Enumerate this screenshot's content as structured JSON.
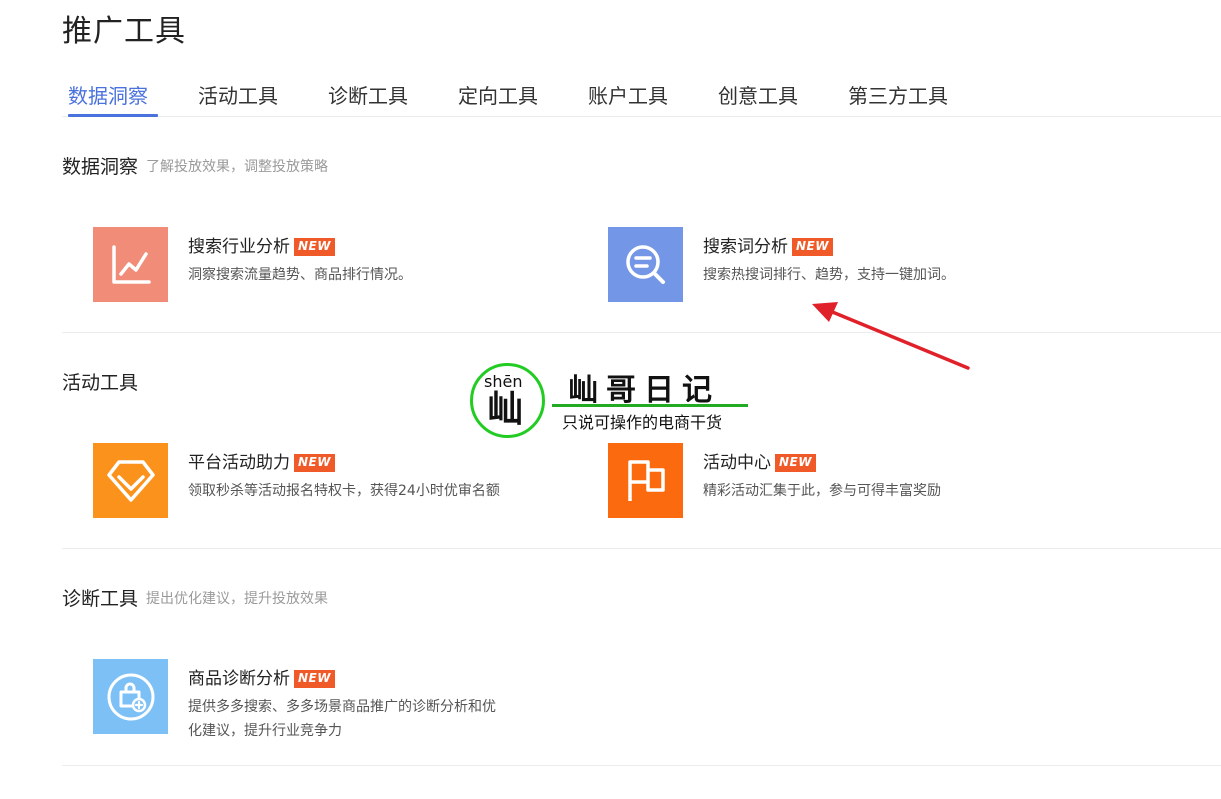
{
  "page_title": "推广工具",
  "tabs": [
    {
      "label": "数据洞察",
      "active": true
    },
    {
      "label": "活动工具",
      "active": false
    },
    {
      "label": "诊断工具",
      "active": false
    },
    {
      "label": "定向工具",
      "active": false
    },
    {
      "label": "账户工具",
      "active": false
    },
    {
      "label": "创意工具",
      "active": false
    },
    {
      "label": "第三方工具",
      "active": false
    }
  ],
  "sections": {
    "insight": {
      "title": "数据洞察",
      "desc": "了解投放效果，调整投放策略",
      "cards": [
        {
          "name": "搜索行业分析",
          "badge": "NEW",
          "desc": "洞察搜索流量趋势、商品排行情况。",
          "icon": "line-chart-icon",
          "color": "#f08c77"
        },
        {
          "name": "搜索词分析",
          "badge": "NEW",
          "desc": "搜索热搜词排行、趋势，支持一键加词。",
          "icon": "search-list-icon",
          "color": "#7397e6"
        }
      ]
    },
    "activity": {
      "title": "活动工具",
      "cards": [
        {
          "name": "平台活动助力",
          "badge": "NEW",
          "desc": "领取秒杀等活动报名特权卡，获得24小时优审名额",
          "icon": "diamond-icon",
          "color": "#fb921b"
        },
        {
          "name": "活动中心",
          "badge": "NEW",
          "desc": "精彩活动汇集于此，参与可得丰富奖励",
          "icon": "flag-icon",
          "color": "#fb6a0f"
        }
      ]
    },
    "diagnosis": {
      "title": "诊断工具",
      "desc": "提出优化建议，提升投放效果",
      "cards": [
        {
          "name": "商品诊断分析",
          "badge": "NEW",
          "desc_lines": [
            "提供多多搜索、多多场景商品推广的诊断分析和优",
            "化建议，提升行业竞争力"
          ],
          "icon": "shopping-bag-plus-icon",
          "color": "#7cc0f6"
        }
      ]
    }
  },
  "watermark": {
    "pinyin": "shēn",
    "char": "屾",
    "title": "屾哥日记",
    "subtitle": "只说可操作的电商干货",
    "ring_color": "#22cc22"
  },
  "annotation": {
    "icon": "red-arrow-icon",
    "color": "#e0212a"
  },
  "colors": {
    "accent": "#4a72dd",
    "badge": "#f05a28"
  }
}
